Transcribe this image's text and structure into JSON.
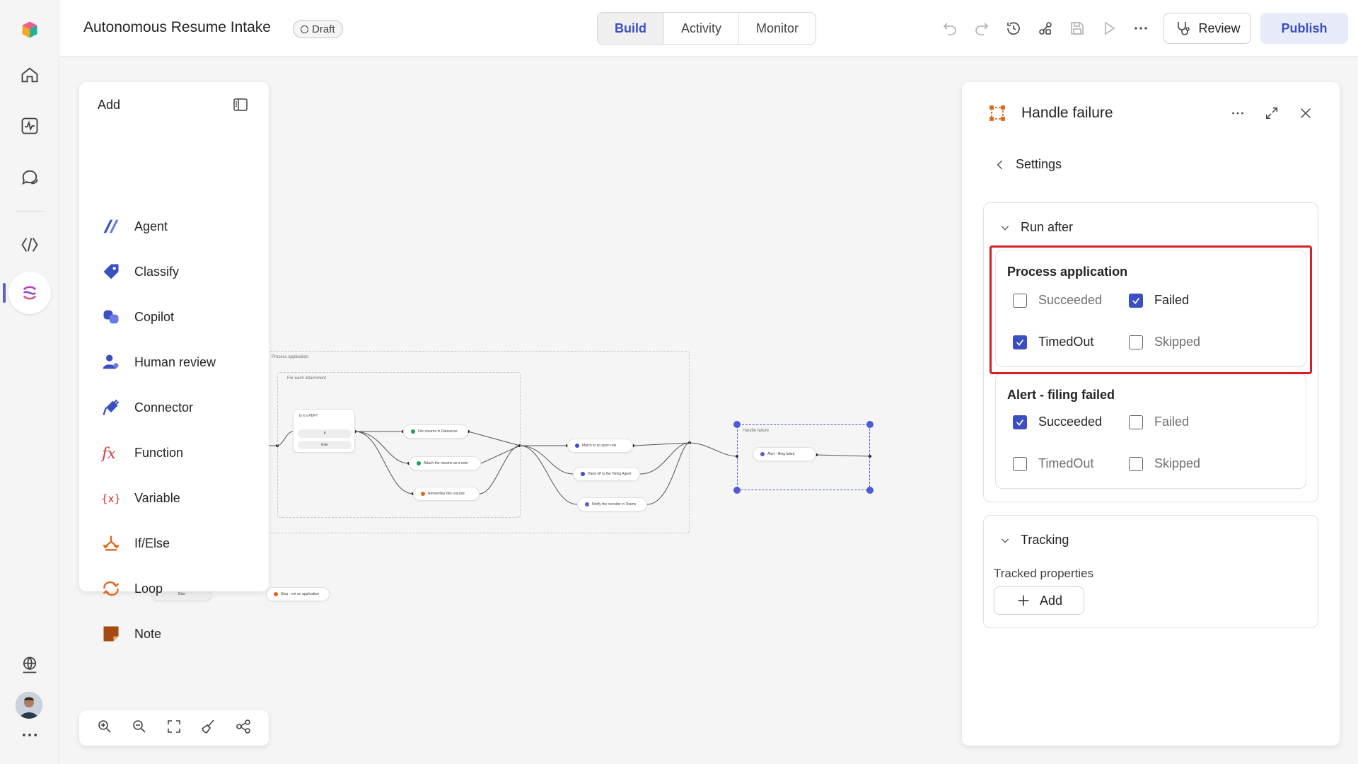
{
  "header": {
    "title": "Autonomous Resume Intake",
    "status_badge": "Draft",
    "tabs": [
      {
        "label": "Build",
        "active": true
      },
      {
        "label": "Activity",
        "active": false
      },
      {
        "label": "Monitor",
        "active": false
      }
    ],
    "review_label": "Review",
    "publish_label": "Publish"
  },
  "add_panel": {
    "title": "Add",
    "items": [
      {
        "label": "Agent",
        "icon": "agent-icon"
      },
      {
        "label": "Classify",
        "icon": "tag-icon"
      },
      {
        "label": "Copilot",
        "icon": "copilot-icon"
      },
      {
        "label": "Human review",
        "icon": "person-icon"
      },
      {
        "label": "Connector",
        "icon": "plug-icon"
      },
      {
        "label": "Function",
        "icon": "fx-icon"
      },
      {
        "label": "Variable",
        "icon": "variable-icon"
      },
      {
        "label": "If/Else",
        "icon": "branch-icon"
      },
      {
        "label": "Loop",
        "icon": "loop-icon"
      },
      {
        "label": "Note",
        "icon": "note-icon"
      }
    ]
  },
  "flow": {
    "group_outer": "Process application",
    "group_inner": "For each attachment",
    "condition": {
      "title": "Is it a PDF?",
      "rows": [
        "If",
        "Else"
      ]
    },
    "nodes": [
      "File resume in Dataverse",
      "Attach the resume as a note",
      "Remember this resume",
      "Match to an open role",
      "Hand off to the Hiring Agent",
      "Notify the recruiter in Teams",
      "Handle failure",
      "Alert - filing failed",
      "Stop - not an application",
      "Else"
    ]
  },
  "properties": {
    "title": "Handle failure",
    "back_label": "Settings",
    "run_after": {
      "heading": "Run after",
      "groups": [
        {
          "title": "Process application",
          "options": [
            {
              "label": "Succeeded",
              "checked": false
            },
            {
              "label": "Failed",
              "checked": true
            },
            {
              "label": "TimedOut",
              "checked": true
            },
            {
              "label": "Skipped",
              "checked": false
            }
          ]
        },
        {
          "title": "Alert - filing failed",
          "options": [
            {
              "label": "Succeeded",
              "checked": true
            },
            {
              "label": "Failed",
              "checked": false
            },
            {
              "label": "TimedOut",
              "checked": false
            },
            {
              "label": "Skipped",
              "checked": false
            }
          ]
        }
      ]
    },
    "tracking": {
      "heading": "Tracking",
      "tracked_label": "Tracked properties",
      "add_label": "Add"
    }
  },
  "colors": {
    "accent": "#3b4fc4",
    "highlight": "#d61f26",
    "selection": "#4f5bd5"
  }
}
